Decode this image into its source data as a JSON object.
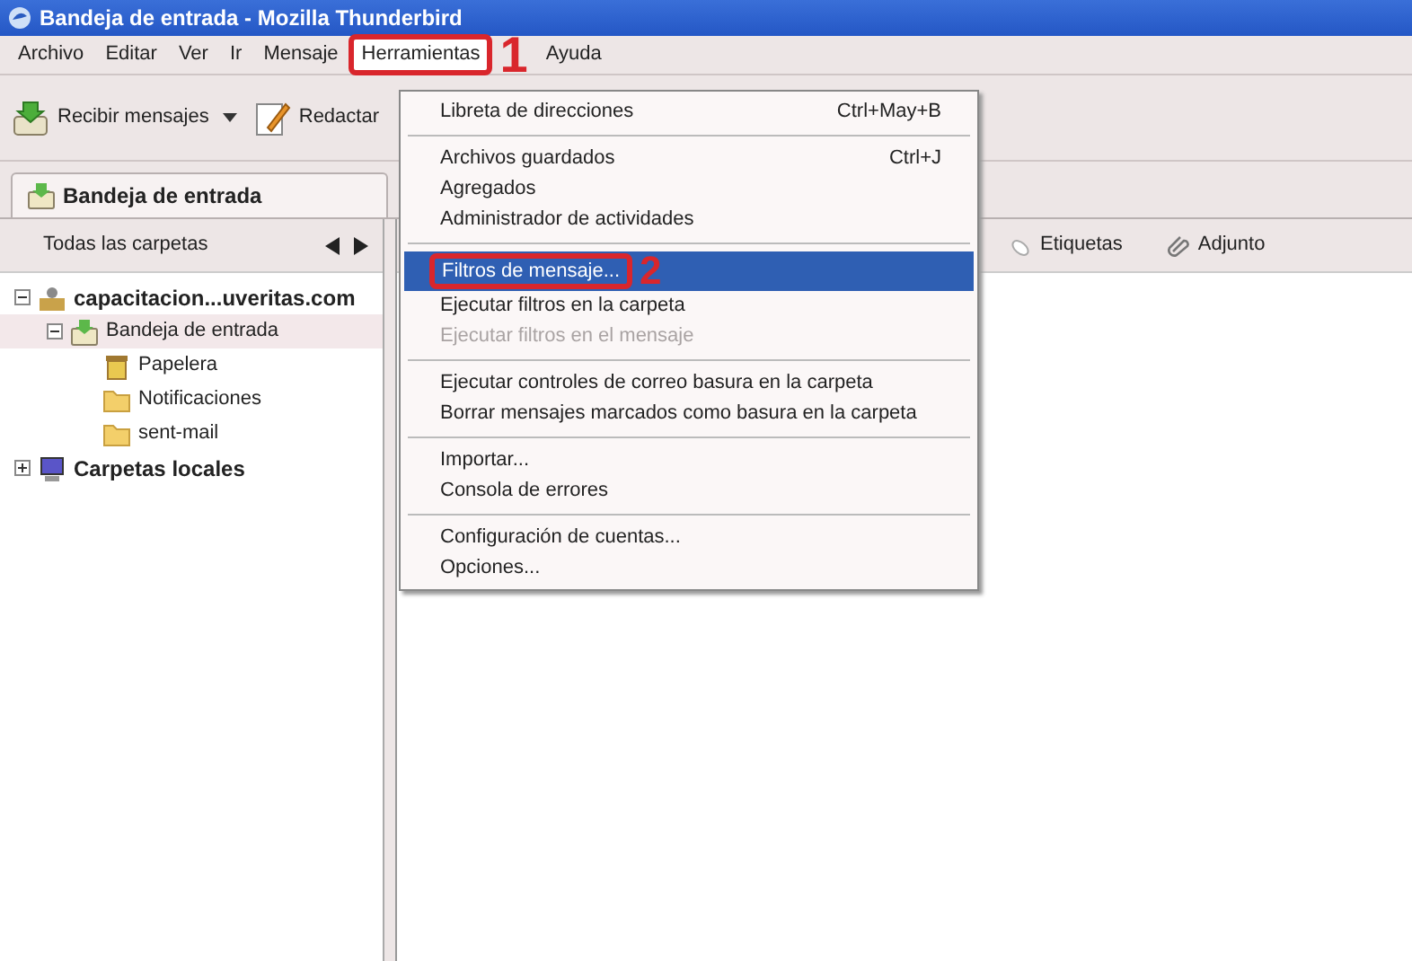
{
  "window": {
    "title": "Bandeja de entrada - Mozilla Thunderbird"
  },
  "menubar": [
    {
      "label": "Archivo",
      "selected": false
    },
    {
      "label": "Editar",
      "selected": false
    },
    {
      "label": "Ver",
      "selected": false
    },
    {
      "label": "Ir",
      "selected": false
    },
    {
      "label": "Mensaje",
      "selected": false
    },
    {
      "label": "Herramientas",
      "selected": true,
      "annotation": "1"
    },
    {
      "label": "Ayuda",
      "selected": false
    }
  ],
  "toolbar": [
    {
      "label": "Recibir mensajes",
      "kind": "receive",
      "dropdown": true
    },
    {
      "label": "Redactar",
      "kind": "compose"
    }
  ],
  "tab": {
    "label": "Bandeja de entrada",
    "selected": true
  },
  "folder_pane": {
    "header": "Todas las carpetas",
    "tree": [
      {
        "label": "capacitacion...uveritas.com",
        "kind": "account",
        "expanded": true,
        "selected": false,
        "children": [
          {
            "label": "Bandeja de entrada",
            "kind": "inbox",
            "expanded": true,
            "selected": true,
            "children": [
              {
                "label": "Papelera",
                "kind": "trash",
                "selected": false
              },
              {
                "label": "Notificaciones",
                "kind": "folder",
                "selected": false
              },
              {
                "label": "sent-mail",
                "kind": "folder",
                "selected": false
              }
            ]
          }
        ]
      },
      {
        "label": "Carpetas locales",
        "kind": "local",
        "expanded": false,
        "selected": false
      }
    ]
  },
  "quick_filter": [
    {
      "label": "Etiquetas",
      "kind": "tag"
    },
    {
      "label": "Adjunto",
      "kind": "attachment"
    }
  ],
  "menu": [
    {
      "kind": "item",
      "label": "Libreta de direcciones",
      "shortcut": "Ctrl+May+B",
      "disabled": false,
      "selected": false
    },
    {
      "kind": "separator"
    },
    {
      "kind": "item",
      "label": "Archivos guardados",
      "shortcut": "Ctrl+J",
      "disabled": false,
      "selected": false
    },
    {
      "kind": "item",
      "label": "Agregados",
      "disabled": false,
      "selected": false
    },
    {
      "kind": "item",
      "label": "Administrador de actividades",
      "disabled": false,
      "selected": false
    },
    {
      "kind": "separator"
    },
    {
      "kind": "item",
      "label": "Filtros de mensaje...",
      "disabled": false,
      "selected": true,
      "annotation": "2"
    },
    {
      "kind": "item",
      "label": "Ejecutar filtros en la carpeta",
      "disabled": false,
      "selected": false
    },
    {
      "kind": "item",
      "label": "Ejecutar filtros en el mensaje",
      "disabled": true,
      "selected": false
    },
    {
      "kind": "separator"
    },
    {
      "kind": "item",
      "label": "Ejecutar controles de correo basura en la carpeta",
      "disabled": false,
      "selected": false
    },
    {
      "kind": "item",
      "label": "Borrar mensajes marcados como basura en la carpeta",
      "disabled": false,
      "selected": false
    },
    {
      "kind": "separator"
    },
    {
      "kind": "item",
      "label": "Importar...",
      "disabled": false,
      "selected": false
    },
    {
      "kind": "item",
      "label": "Consola de errores",
      "disabled": false,
      "selected": false
    },
    {
      "kind": "separator"
    },
    {
      "kind": "item",
      "label": "Configuración de cuentas...",
      "disabled": false,
      "selected": false
    },
    {
      "kind": "item",
      "label": "Opciones...",
      "disabled": false,
      "selected": false
    }
  ]
}
